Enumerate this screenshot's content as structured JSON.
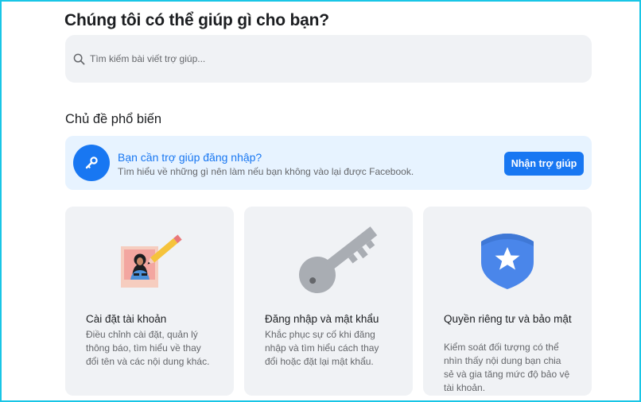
{
  "header": {
    "title": "Chúng tôi có thể giúp gì cho bạn?"
  },
  "search": {
    "placeholder": "Tìm kiếm bài viết trợ giúp...",
    "icon": "search-icon"
  },
  "popular": {
    "title": "Chủ đề phổ biến"
  },
  "login_help": {
    "title": "Bạn cần trợ giúp đăng nhập?",
    "subtitle": "Tìm hiểu về những gì nên làm nếu bạn không vào lại được Facebook.",
    "button_label": "Nhận trợ giúp",
    "icon": "key-icon"
  },
  "topics": [
    {
      "title": "Cài đặt tài khoản",
      "description": "Điều chỉnh cài đặt, quản lý thông báo, tìm hiểu về thay đổi tên và các nội dung khác.",
      "icon": "profile-edit-icon"
    },
    {
      "title": "Đăng nhập và mật khẩu",
      "description": "Khắc phục sự cố khi đăng nhập và tìm hiểu cách thay đổi hoặc đặt lại mật khẩu.",
      "icon": "key-icon"
    },
    {
      "title": "Quyền riêng tư và bảo mật",
      "description": "Kiểm soát đối tượng có thể nhìn thấy nội dung bạn chia sẻ và gia tăng mức độ bảo vệ tài khoản.",
      "icon": "shield-star-icon"
    }
  ],
  "colors": {
    "brand": "#1877f2",
    "banner_bg": "#e7f3ff",
    "card_bg": "#f0f2f5",
    "frame": "#19c6e6"
  }
}
